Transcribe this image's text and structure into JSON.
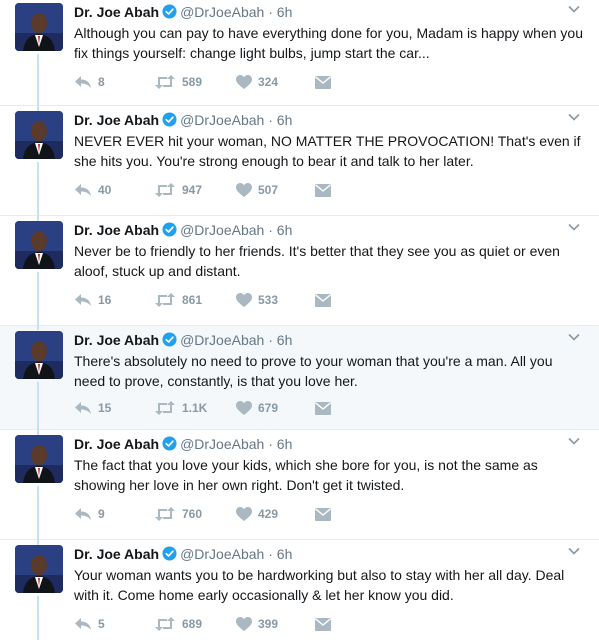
{
  "colors": {
    "thread_line": "#c4e4f5",
    "verified": "#1da1f2",
    "meta_gray": "#657786",
    "highlight_bg": "#f5f8fa"
  },
  "tweets": [
    {
      "name": "Dr. Joe Abah",
      "handle": "@DrJoeAbah",
      "dot": "·",
      "time": "6h",
      "text": "Although you can pay to have everything done for you, Madam is happy when you fix things yourself: change light bulbs, jump start the car...",
      "replies": "8",
      "retweets": "589",
      "likes": "324"
    },
    {
      "name": "Dr. Joe Abah",
      "handle": "@DrJoeAbah",
      "dot": "·",
      "time": "6h",
      "text": "NEVER EVER hit your woman, NO MATTER THE PROVOCATION! That's even if she hits you. You're strong enough to bear it and talk to her later.",
      "replies": "40",
      "retweets": "947",
      "likes": "507"
    },
    {
      "name": "Dr. Joe Abah",
      "handle": "@DrJoeAbah",
      "dot": "·",
      "time": "6h",
      "text": "Never be to friendly to her friends. It's better that they see you as quiet or even aloof, stuck up and distant.",
      "replies": "16",
      "retweets": "861",
      "likes": "533"
    },
    {
      "name": "Dr. Joe Abah",
      "handle": "@DrJoeAbah",
      "dot": "·",
      "time": "6h",
      "text": "There's absolutely no need to prove to your woman that you're a man. All you need to prove, constantly, is that you love her.",
      "replies": "15",
      "retweets": "1.1K",
      "likes": "679"
    },
    {
      "name": "Dr. Joe Abah",
      "handle": "@DrJoeAbah",
      "dot": "·",
      "time": "6h",
      "text": "The fact that you love your kids, which she bore for you, is not the same as showing her love in her own right. Don't get it twisted.",
      "replies": "9",
      "retweets": "760",
      "likes": "429"
    },
    {
      "name": "Dr. Joe Abah",
      "handle": "@DrJoeAbah",
      "dot": "·",
      "time": "6h",
      "text": "Your woman wants you to be hardworking but also to stay with her all day. Deal with it. Come home early occasionally & let her know you did.",
      "replies": "5",
      "retweets": "689",
      "likes": "399"
    }
  ]
}
